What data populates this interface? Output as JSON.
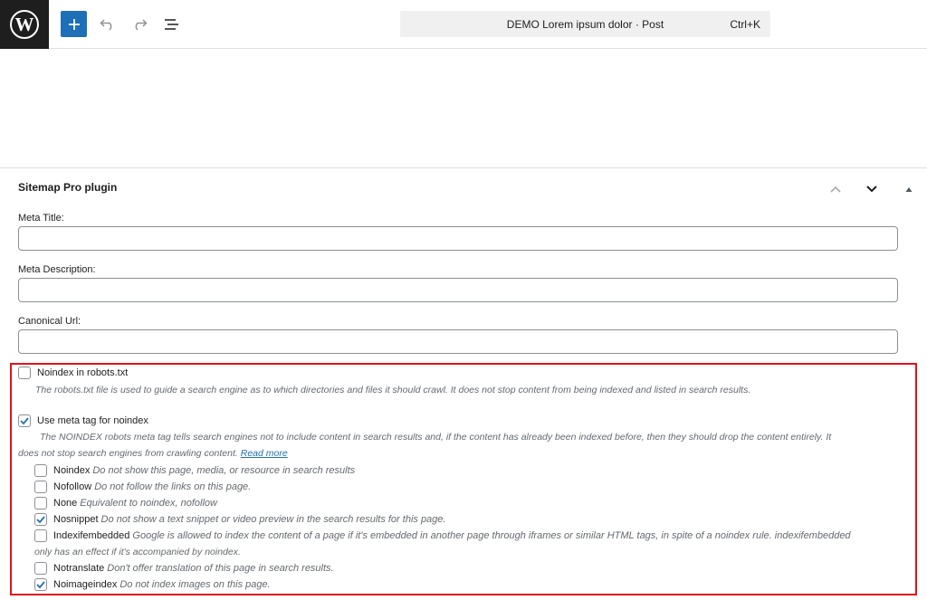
{
  "header": {
    "logo_icon": "wordpress-logo-icon",
    "add_icon": "plus-icon",
    "undo_icon": "undo-icon",
    "redo_icon": "redo-icon",
    "list_view_icon": "list-view-icon",
    "command_title": "DEMO Lorem ipsum dolor · Post",
    "command_shortcut": "Ctrl+K",
    "accent_color": "#1d6fb8"
  },
  "metabox": {
    "title": "Sitemap Pro plugin",
    "move_up_icon": "chevron-up-icon",
    "move_down_icon": "chevron-down-icon",
    "toggle_icon": "triangle-up-icon",
    "fields": [
      {
        "label": "Meta Title:",
        "value": ""
      },
      {
        "label": "Meta Description:",
        "value": ""
      },
      {
        "label": "Canonical Url:",
        "value": ""
      }
    ],
    "noindex_robots": {
      "label": "Noindex in robots.txt",
      "checked": false,
      "description": "The robots.txt file is used to guide a search engine as to which directories and files it should crawl. It does not stop content from being indexed and listed in search results."
    },
    "meta_noindex": {
      "label": "Use meta tag for noindex",
      "checked": true,
      "description_line1": "The NOINDEX robots meta tag tells search engines not to include content in search results and, if the content has already been indexed before, then they should drop the content entirely. It",
      "description_line2": "does not stop search engines from crawling content.",
      "read_more": "Read more"
    },
    "options": [
      {
        "name": "Noindex",
        "desc": "Do not show this page, media, or resource in search results",
        "checked": false
      },
      {
        "name": "Nofollow",
        "desc": "Do not follow the links on this page.",
        "checked": false
      },
      {
        "name": "None",
        "desc": "Equivalent to noindex, nofollow",
        "checked": false
      },
      {
        "name": "Nosnippet",
        "desc": "Do not show a text snippet or video preview in the search results for this page.",
        "checked": true
      },
      {
        "name": "Indexifembedded",
        "desc": "Google is allowed to index the content of a page if it's embedded in another page through iframes or similar HTML tags, in spite of a noindex rule. indexifembedded",
        "desc_line2": "only has an effect if it's accompanied by noindex.",
        "checked": false
      },
      {
        "name": "Notranslate",
        "desc": "Don't offer translation of this page in search results.",
        "checked": false
      },
      {
        "name": "Noimageindex",
        "desc": "Do not index images on this page.",
        "checked": true
      }
    ],
    "highlight_color": "#e0141b"
  }
}
